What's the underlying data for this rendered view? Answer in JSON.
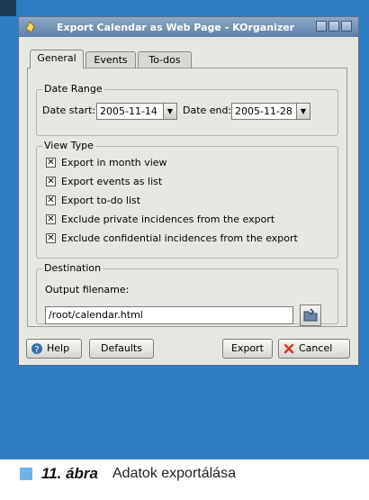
{
  "window": {
    "title": "Export Calendar as Web Page - KOrganizer"
  },
  "tabs": [
    {
      "label": "General",
      "active": true
    },
    {
      "label": "Events",
      "active": false
    },
    {
      "label": "To-dos",
      "active": false
    }
  ],
  "date_range": {
    "legend": "Date Range",
    "start_label": "Date start:",
    "start_value": "2005-11-14",
    "end_label": "Date end:",
    "end_value": "2005-11-28"
  },
  "view_type": {
    "legend": "View Type",
    "options": [
      {
        "label": "Export in month view",
        "checked": true
      },
      {
        "label": "Export events as list",
        "checked": true
      },
      {
        "label": "Export to-do list",
        "checked": true
      },
      {
        "label": "Exclude private incidences from the export",
        "checked": true
      },
      {
        "label": "Exclude confidential incidences from the export",
        "checked": true
      }
    ]
  },
  "destination": {
    "legend": "Destination",
    "filename_label": "Output filename:",
    "filename_value": "/root/calendar.html"
  },
  "buttons": {
    "help": "Help",
    "defaults": "Defaults",
    "export": "Export",
    "cancel": "Cancel"
  },
  "caption": {
    "number": "11. ábra",
    "text": "Adatok exportálása"
  },
  "colors": {
    "background_blue": "#2f7dc2",
    "dialog_gray": "#e7e7e2",
    "titlebar": "#6f8db4",
    "caption_square": "#6fb2e3"
  }
}
